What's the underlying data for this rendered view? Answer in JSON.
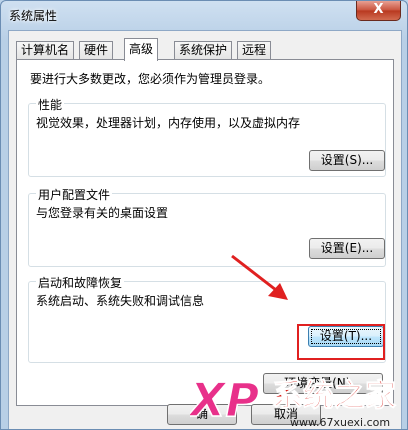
{
  "window": {
    "title": "系统属性",
    "close_label": "X"
  },
  "tabs": [
    {
      "label": "计算机名",
      "active": false
    },
    {
      "label": "硬件",
      "active": false
    },
    {
      "label": "高级",
      "active": true
    },
    {
      "label": "系统保护",
      "active": false
    },
    {
      "label": "远程",
      "active": false
    }
  ],
  "panel": {
    "admin_note": "要进行大多数更改，您必须作为管理员登录。",
    "performance": {
      "title": "性能",
      "description": "视觉效果，处理器计划，内存使用，以及虚拟内存",
      "button": "设置(S)..."
    },
    "user_profiles": {
      "title": "用户配置文件",
      "description": "与您登录有关的桌面设置",
      "button": "设置(E)..."
    },
    "startup_recovery": {
      "title": "启动和故障恢复",
      "description": "系统启动、系统失败和调试信息",
      "button": "设置(T)..."
    },
    "env_button": "环境变量(N)..."
  },
  "bottom": {
    "ok_partial": "确",
    "cancel_partial": "取消"
  },
  "watermark": {
    "logo_text": "XP",
    "site_name": "系统之家",
    "url": "www.67xuexi.com"
  },
  "colors": {
    "annotation": "#e02020",
    "focus_button": "#a7d9f5",
    "watermark_pink": "#e8308a",
    "watermark_red": "#d8201a"
  }
}
